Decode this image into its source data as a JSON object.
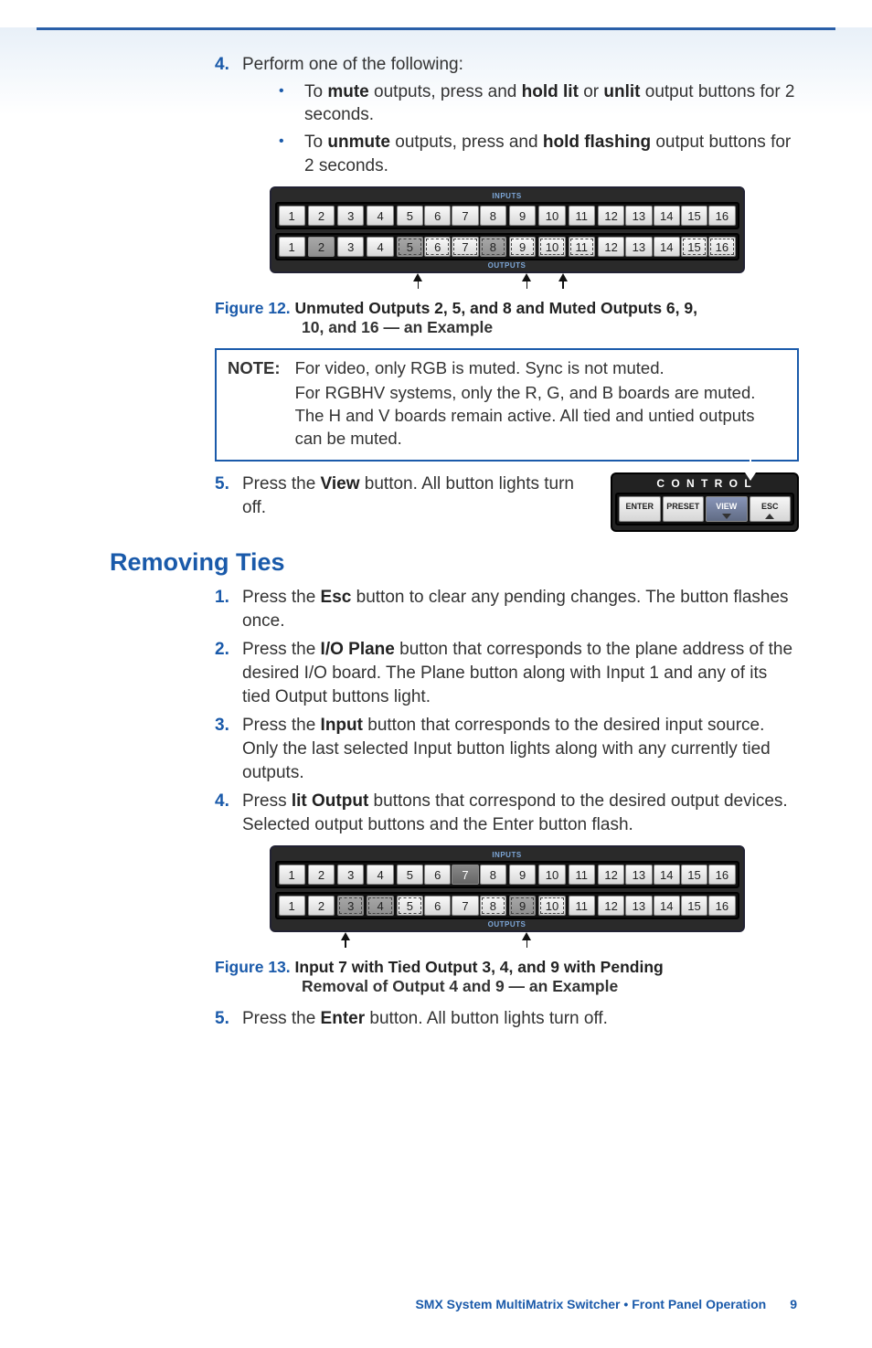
{
  "step4": {
    "num": "4.",
    "text": "Perform one of the following:",
    "bullets": [
      {
        "pre": "To ",
        "b1": "mute",
        "mid": " outputs, press and ",
        "b2": "hold lit",
        "mid2": " or ",
        "b3": "unlit",
        "post": " output buttons for 2 seconds."
      },
      {
        "pre": "To ",
        "b1": "unmute",
        "mid": " outputs, press and ",
        "b2": "hold flashing",
        "mid2": "",
        "b3": "",
        "post": " output buttons for 2 seconds."
      }
    ]
  },
  "fig12": {
    "inputs_label": "INPUTS",
    "outputs_label": "OUTPUTS",
    "inputs": [
      "1",
      "2",
      "3",
      "4",
      "5",
      "6",
      "7",
      "8",
      "9",
      "10",
      "11",
      "12",
      "13",
      "14",
      "15",
      "16"
    ],
    "outputs": [
      "1",
      "2",
      "3",
      "4",
      "5",
      "6",
      "7",
      "8",
      "9",
      "10",
      "11",
      "12",
      "13",
      "14",
      "15",
      "16"
    ],
    "label": "Figure 12.",
    "caption": "Unmuted Outputs 2, 5, and 8 and Muted Outputs 6, 9, 10, and 16 — an Example"
  },
  "note": {
    "label": "NOTE:",
    "line1": "For video, only RGB is muted. Sync is not muted.",
    "line2": "For RGBHV systems, only the R, G, and B boards are muted. The H and V boards remain active. All tied and untied outputs can be muted."
  },
  "step5a": {
    "num": "5.",
    "pre": "Press the ",
    "bold": "View",
    "post": " button. All button lights turn off."
  },
  "control": {
    "title": "C O N T R O L",
    "enter": "ENTER",
    "preset": "PRESET",
    "view": "VIEW",
    "esc": "ESC"
  },
  "section2": {
    "title": "Removing Ties"
  },
  "rt1": {
    "num": "1.",
    "pre": "Press the ",
    "bold": "Esc",
    "post": " button to clear any pending changes. The button flashes once."
  },
  "rt2": {
    "num": "2.",
    "pre": "Press the ",
    "bold": "I/O Plane",
    "post": " button that corresponds to the plane address of the desired I/O board. The Plane button along with Input 1 and any of its tied Output buttons light."
  },
  "rt3": {
    "num": "3.",
    "pre": "Press the ",
    "bold": "Input",
    "post": " button that corresponds to the desired input source. Only the last selected Input button lights along with any currently tied outputs."
  },
  "rt4": {
    "num": "4.",
    "pre": "Press ",
    "bold": "lit Output",
    "post": " buttons that correspond to the desired output devices. Selected output buttons and the Enter button flash."
  },
  "fig13": {
    "inputs_label": "INPUTS",
    "outputs_label": "OUTPUTS",
    "inputs": [
      "1",
      "2",
      "3",
      "4",
      "5",
      "6",
      "7",
      "8",
      "9",
      "10",
      "11",
      "12",
      "13",
      "14",
      "15",
      "16"
    ],
    "outputs": [
      "1",
      "2",
      "3",
      "4",
      "5",
      "6",
      "7",
      "8",
      "9",
      "10",
      "11",
      "12",
      "13",
      "14",
      "15",
      "16"
    ],
    "label": "Figure 13.",
    "caption": "Input 7 with Tied Output 3, 4, and 9 with Pending Removal of Output 4 and 9 — an Example"
  },
  "rt5": {
    "num": "5.",
    "pre": "Press the ",
    "bold": "Enter",
    "post": " button. All button lights turn off."
  },
  "footer": {
    "doc": "SMX System MultiMatrix Switcher",
    "sep": " • ",
    "chapter": "Front Panel Operation",
    "page": "9"
  }
}
